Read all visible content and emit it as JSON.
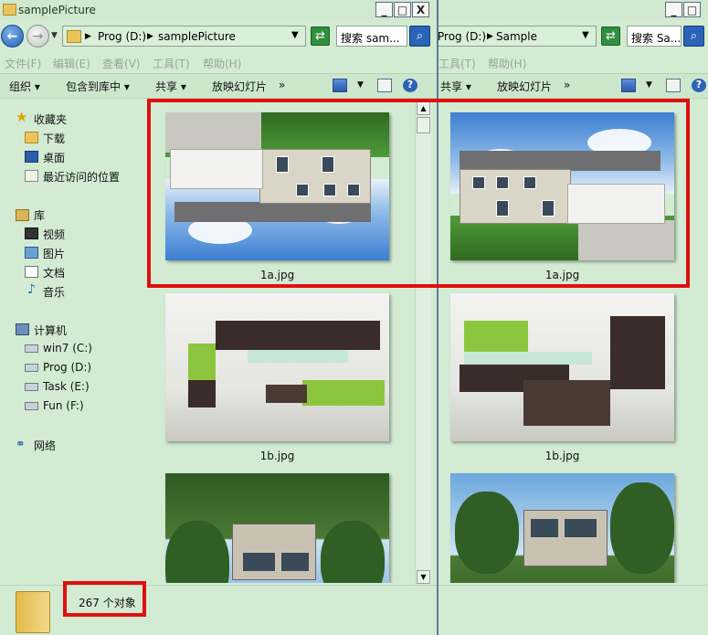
{
  "left_window": {
    "title": "samplePicture",
    "address": {
      "drive": "Prog (D:)",
      "folder": "samplePicture"
    },
    "search_placeholder": "搜索 sam...",
    "menu": [
      "文件(F)",
      "编辑(E)",
      "查看(V)",
      "工具(T)",
      "帮助(H)"
    ],
    "commands": {
      "organize": "组织",
      "include": "包含到库中",
      "share": "共享",
      "slideshow": "放映幻灯片",
      "more": "»"
    },
    "nav": {
      "favorites": "收藏夹",
      "favorites_items": [
        "下载",
        "桌面",
        "最近访问的位置"
      ],
      "libraries": "库",
      "library_items": [
        "视频",
        "图片",
        "文档",
        "音乐"
      ],
      "computer": "计算机",
      "drives": [
        "win7 (C:)",
        "Prog (D:)",
        "Task (E:)",
        "Fun (F:)"
      ],
      "network": "网络"
    },
    "files": [
      "1a.jpg",
      "1b.jpg"
    ],
    "status": "267 个对象"
  },
  "right_window": {
    "address": {
      "drive": "Prog (D:)",
      "folder": "Sample"
    },
    "search_placeholder": "搜索 Sa...",
    "menu": [
      "工具(T)",
      "帮助(H)"
    ],
    "commands": {
      "share": "共享",
      "slideshow": "放映幻灯片",
      "more": "»"
    },
    "files": [
      "1a.jpg",
      "1b.jpg"
    ]
  },
  "window_buttons": {
    "minimize": "_",
    "maximize": "□",
    "close": "X"
  },
  "colors": {
    "highlight": "#e01010",
    "window_bg": "#d2ebd2",
    "accent": "#2a63b8"
  },
  "icons": {
    "back": "back-arrow-icon",
    "forward": "forward-arrow-icon",
    "refresh": "refresh-icon",
    "search": "search-icon",
    "views": "views-icon",
    "preview_pane": "preview-pane-icon",
    "help": "help-icon"
  }
}
